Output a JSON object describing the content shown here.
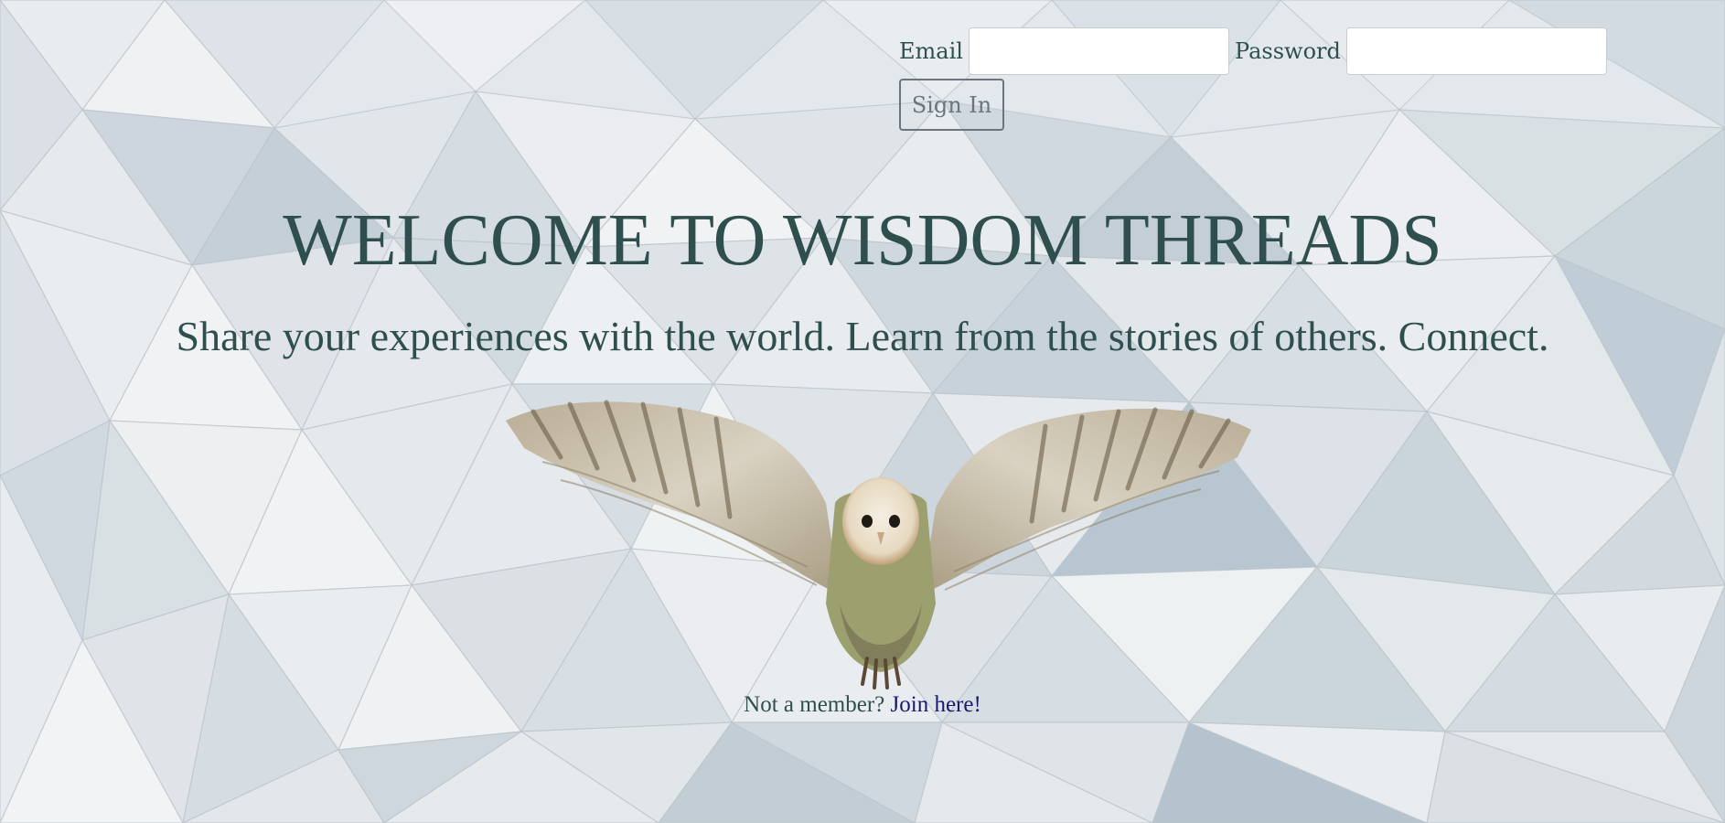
{
  "colors": {
    "heading": "#2f4f4f",
    "link": "#191970",
    "button_border": "#6c757d",
    "background": "#dfe5ea"
  },
  "login": {
    "email_label": "Email",
    "email_value": "",
    "password_label": "Password",
    "password_value": "",
    "signin_label": "Sign In"
  },
  "hero": {
    "title": "WELCOME TO WISDOM THREADS",
    "subtitle": "Share your experiences with the world. Learn from the stories of others. Connect.",
    "image": "barn-owl-flying"
  },
  "footer": {
    "prompt": "Not a member?",
    "join_link": "Join here!"
  }
}
